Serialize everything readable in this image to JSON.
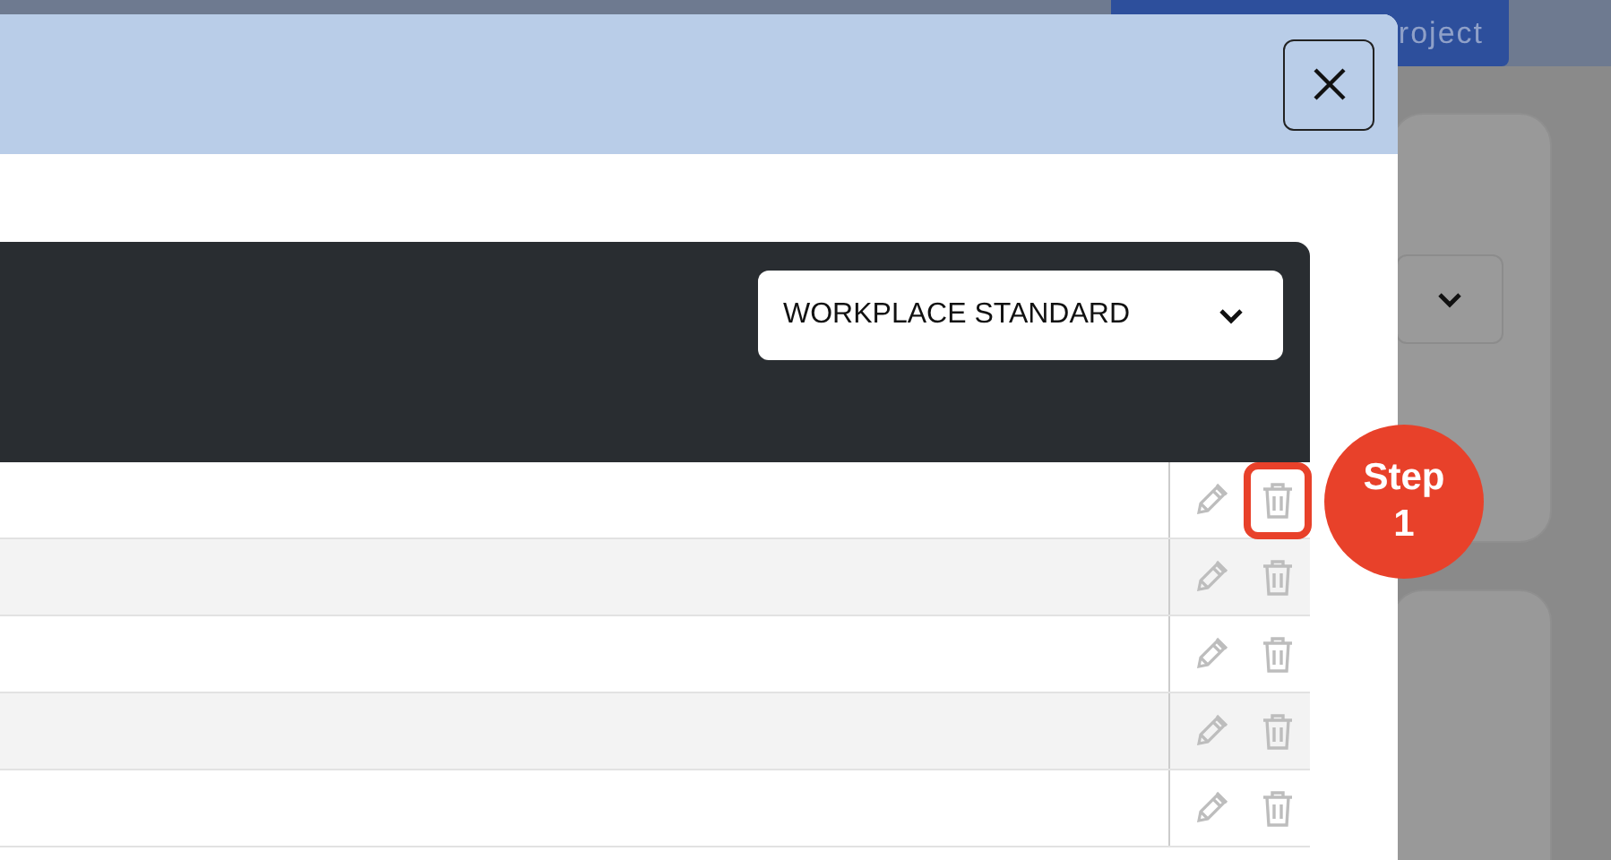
{
  "background": {
    "header_button": "roject"
  },
  "modal": {
    "dropdown": {
      "value": "WORKPLACE STANDARD"
    },
    "rows": [
      {
        "highlighted": true
      },
      {
        "highlighted": false
      },
      {
        "highlighted": false
      },
      {
        "highlighted": false
      },
      {
        "highlighted": false
      }
    ]
  },
  "callout": {
    "label": "Step 1"
  }
}
